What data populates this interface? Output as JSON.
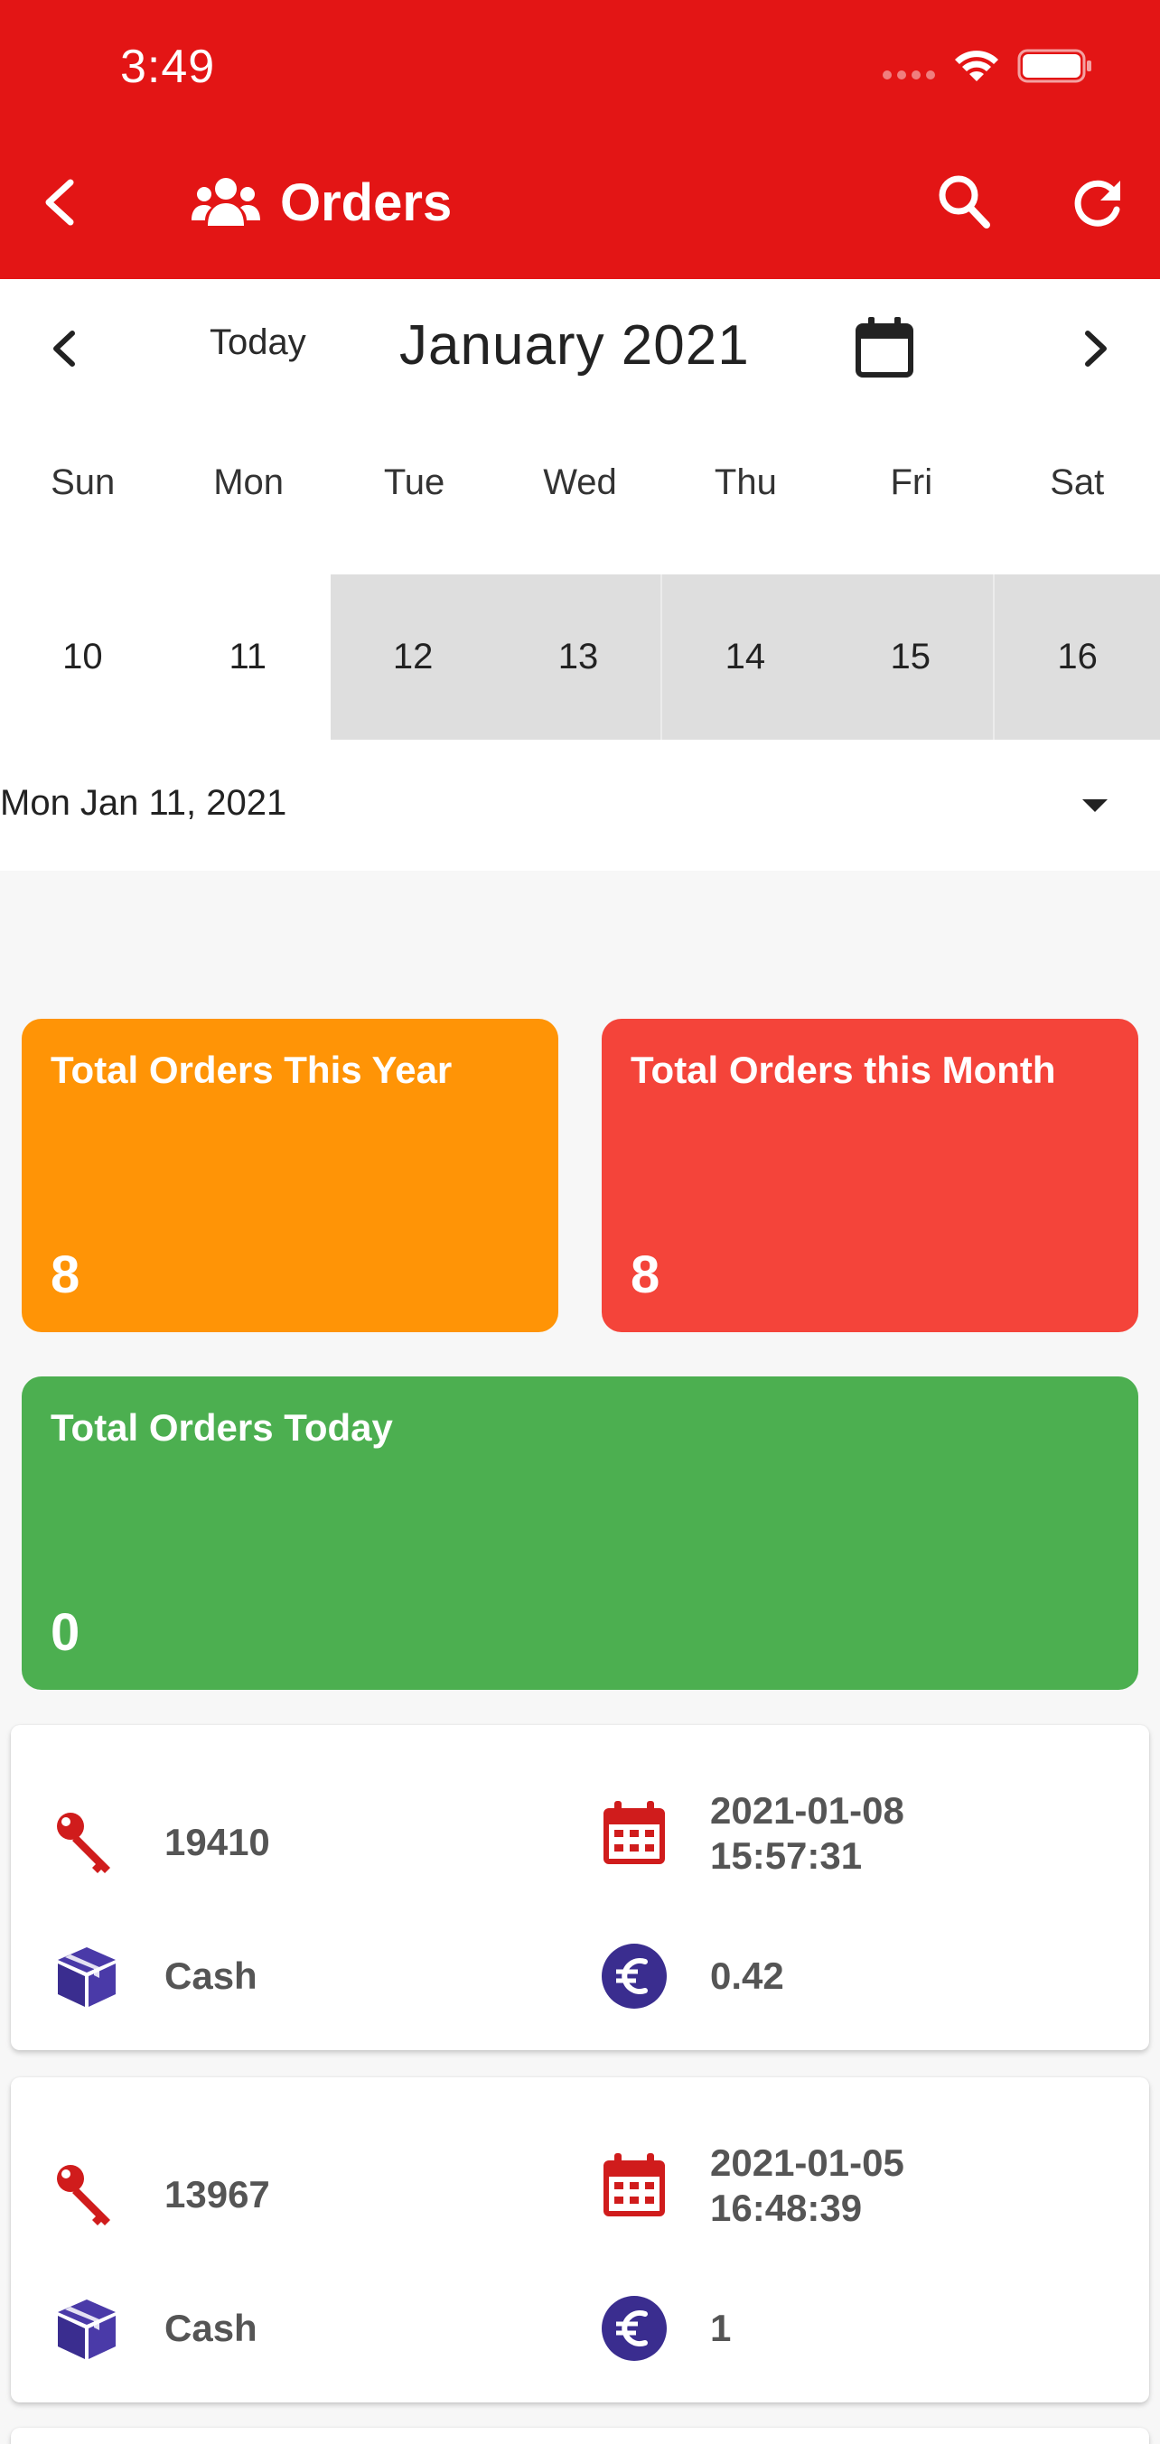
{
  "status_bar": {
    "time": "3:49"
  },
  "header": {
    "title": "Orders",
    "color": "#e31515"
  },
  "calendar": {
    "today_label": "Today",
    "month_label": "January 2021",
    "weekdays": [
      "Sun",
      "Mon",
      "Tue",
      "Wed",
      "Thu",
      "Fri",
      "Sat"
    ],
    "days": [
      "10",
      "11",
      "12",
      "13",
      "14",
      "15",
      "16"
    ],
    "selected_date": "Mon Jan 11, 2021"
  },
  "summary": {
    "year": {
      "title": "Total Orders This Year",
      "value": "8",
      "color": "#ff9406"
    },
    "month": {
      "title": "Total Orders this Month",
      "value": "8",
      "color": "#f4443a"
    },
    "today": {
      "title": "Total Orders Today",
      "value": "0",
      "color": "#4caf50"
    }
  },
  "orders": [
    {
      "id": "19410",
      "date": "2021-01-08",
      "time": "15:57:31",
      "payment": "Cash",
      "amount": "0.42"
    },
    {
      "id": "13967",
      "date": "2021-01-05",
      "time": "16:48:39",
      "payment": "Cash",
      "amount": "1"
    }
  ],
  "icons": {
    "id": "key-icon",
    "date": "calendar-icon",
    "payment": "box-icon",
    "amount": "euro-icon"
  }
}
